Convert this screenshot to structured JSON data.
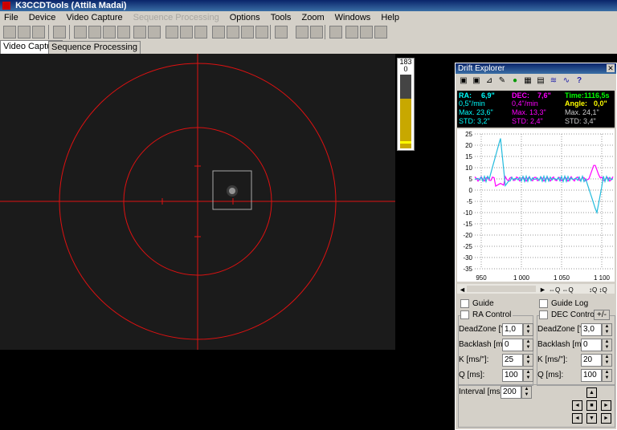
{
  "app": {
    "title": "K3CCDTools (Attila Madai)"
  },
  "menu": [
    "File",
    "Device",
    "Video Capture",
    "Sequence Processing",
    "Options",
    "Tools",
    "Zoom",
    "Windows",
    "Help"
  ],
  "tabs": [
    "Video Capture",
    "Sequence Processing"
  ],
  "histogram": {
    "max": "183",
    "min": "0"
  },
  "drift": {
    "title": "Drift Explorer",
    "ra": {
      "label": "RA:",
      "value": "6,9\"",
      "rate": "0,5\"/min",
      "max": "Max. 23,6\"",
      "std": "STD: 3,2\""
    },
    "dec": {
      "label": "DEC:",
      "value": "7,6\"",
      "rate": "0,4\"/min",
      "max": "Max. 13,3\"",
      "std": "STD: 2,4\""
    },
    "time": {
      "label": "Time:",
      "value": "1116,5s"
    },
    "angle": {
      "label": "Angle:",
      "value": "0,0\"",
      "max": "Max. 24,1\"",
      "std": "STD: 3,4\""
    },
    "chart": {
      "y_ticks": [
        "25",
        "20",
        "15",
        "10",
        "5",
        "0",
        "-5",
        "-10",
        "-15",
        "-20",
        "-25",
        "-30",
        "-35"
      ],
      "x_ticks": [
        "950",
        "1 000",
        "1 050",
        "1 100"
      ]
    }
  },
  "controls": {
    "guide": "Guide",
    "guide_log": "Guide Log",
    "ra_control": "RA Control",
    "dec_control": "DEC Control",
    "plusminus": "+/-",
    "deadzone": "DeadZone [\"]:",
    "backlash": "Backlash [ms]:",
    "k": "K [ms/\"]:",
    "q": "Q [ms]:",
    "interval": "Interval [ms]:",
    "ra_values": {
      "deadzone": "1,0",
      "backlash": "0",
      "k": "25",
      "q": "100"
    },
    "dec_values": {
      "deadzone": "3,0",
      "backlash": "0",
      "k": "20",
      "q": "100"
    },
    "interval_value": "200"
  }
}
